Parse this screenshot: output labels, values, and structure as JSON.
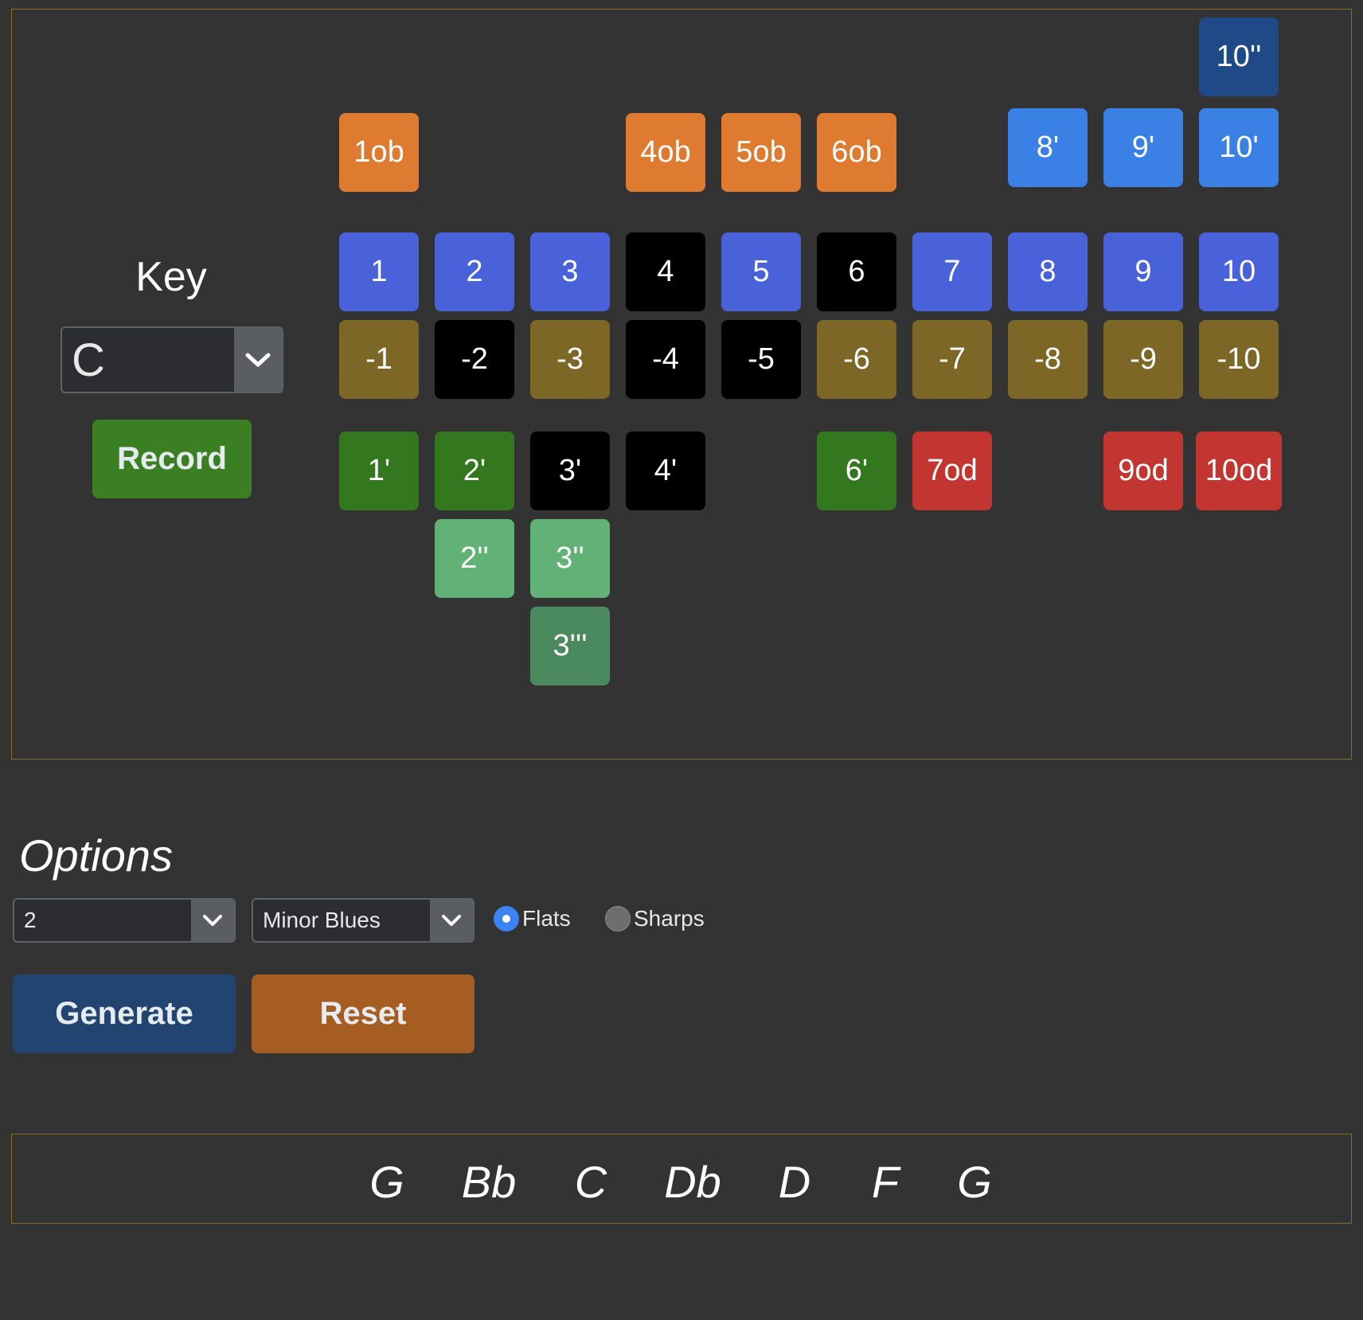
{
  "key": {
    "label": "Key",
    "value": "C"
  },
  "record": {
    "label": "Record"
  },
  "tiles": {
    "t10pp": "10''",
    "t1ob": "1ob",
    "t4ob": "4ob",
    "t5ob": "5ob",
    "t6ob": "6ob",
    "t8p": "8'",
    "t9p": "9'",
    "t10p": "10'",
    "b1": "1",
    "b2": "2",
    "b3": "3",
    "b4": "4",
    "b5": "5",
    "b6": "6",
    "b7": "7",
    "b8": "8",
    "b9": "9",
    "b10": "10",
    "d1": "-1",
    "d2": "-2",
    "d3": "-3",
    "d4": "-4",
    "d5": "-5",
    "d6": "-6",
    "d7": "-7",
    "d8": "-8",
    "d9": "-9",
    "d10": "-10",
    "e1": "1'",
    "e2": "2'",
    "e3": "3'",
    "e4": "4'",
    "e6": "6'",
    "e7": "7od",
    "e9": "9od",
    "e10": "10od",
    "f2": "2''",
    "f3": "3''",
    "g3": "3'''"
  },
  "options": {
    "title": "Options",
    "octave_value": "2",
    "scale_value": "Minor Blues",
    "accidentals": {
      "flats_label": "Flats",
      "sharps_label": "Sharps",
      "selected": "Flats"
    },
    "generate_label": "Generate",
    "reset_label": "Reset"
  },
  "scale_notes": [
    "G",
    "Bb",
    "C",
    "Db",
    "D",
    "F",
    "G"
  ],
  "colors": {
    "blow": "#4962d9",
    "draw": "#7c6727",
    "overblow": "#df7b30",
    "blow_bend": "#3b80e4",
    "draw_bend": "#33781f",
    "overdraw": "#c23531",
    "out_of_scale": "#000000",
    "record": "#3a8023",
    "generate": "#214570",
    "reset": "#a65d22",
    "border": "#8a6d2b"
  }
}
